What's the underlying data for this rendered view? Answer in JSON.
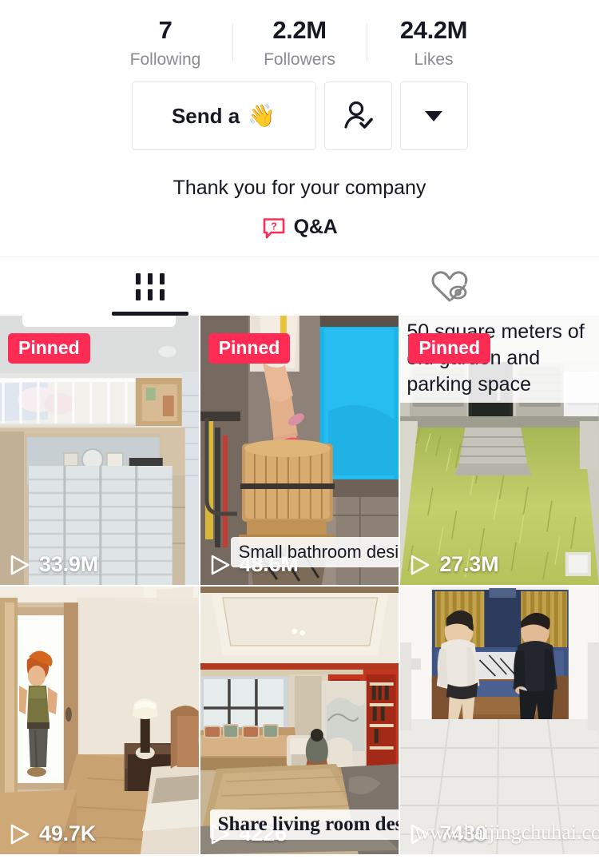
{
  "stats": [
    {
      "value": "7",
      "label": "Following",
      "name": "following"
    },
    {
      "value": "2.2M",
      "label": "Followers",
      "name": "followers"
    },
    {
      "value": "24.2M",
      "label": "Likes",
      "name": "likes"
    }
  ],
  "actions": {
    "message_label": "Send a",
    "message_emoji": "👋",
    "follow_icon": "person-check-icon",
    "more_icon": "chevron-down-icon"
  },
  "bio": {
    "text": "Thank you for your company",
    "qa_label": "Q&A",
    "qa_icon": "question-bubble-icon"
  },
  "tabs": [
    {
      "name": "videos",
      "icon": "grid-icon",
      "active": true
    },
    {
      "name": "private-likes",
      "icon": "heart-eye-slash-icon",
      "active": false
    }
  ],
  "colors": {
    "accent": "#fe2c55",
    "text": "#161823",
    "muted": "#8a8b91",
    "border": "#e4e4e6"
  },
  "videos": [
    {
      "id": "v1",
      "views": "33.9M",
      "pinned": true,
      "pinned_label": "Pinned",
      "caption": "",
      "scene": "bedroom-loft-bed-white-wardrobe"
    },
    {
      "id": "v2",
      "views": "48.6M",
      "pinned": true,
      "pinned_label": "Pinned",
      "caption": "Small bathroom design",
      "scene": "bathroom-wooden-tub-blue-window"
    },
    {
      "id": "v3",
      "views": "27.3M",
      "pinned": true,
      "pinned_label": "Pinned",
      "caption": "50 square meters of old garden and parking space",
      "scene": "overgrown-grass-yard-front-door"
    },
    {
      "id": "v4",
      "views": "49.7K",
      "pinned": false,
      "pinned_label": "",
      "caption": "",
      "scene": "3d-render-person-entering-bedroom"
    },
    {
      "id": "v5",
      "views": "4226",
      "pinned": false,
      "pinned_label": "",
      "caption": "Share living room design",
      "scene": "chinese-style-living-room-red-shelves"
    },
    {
      "id": "v6",
      "views": "7430",
      "pinned": false,
      "pinned_label": "",
      "caption": "",
      "watermark": "www.haijingchuhai.com",
      "scene": "two-people-sitting-on-sofa-tiled-floor"
    }
  ]
}
